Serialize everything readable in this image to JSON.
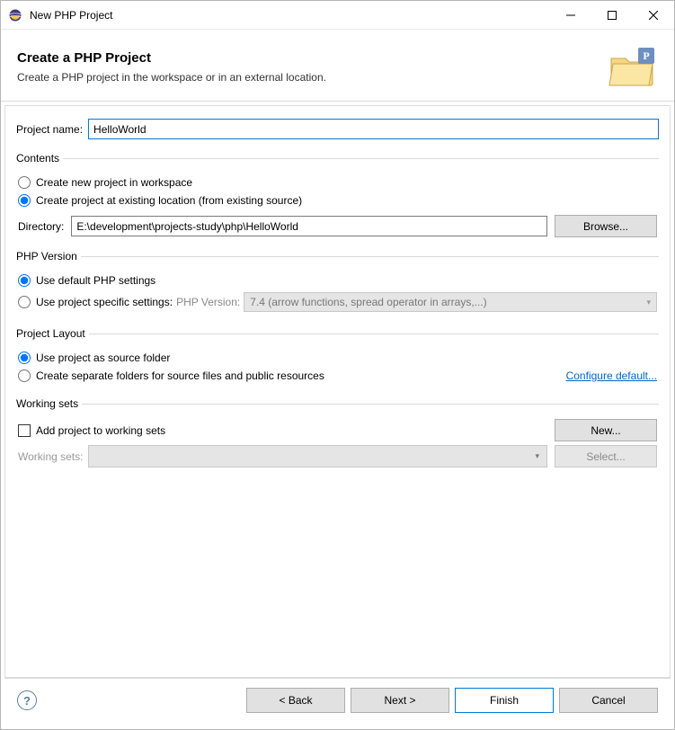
{
  "window": {
    "title": "New PHP Project"
  },
  "header": {
    "title": "Create a PHP Project",
    "subtitle": "Create a PHP project in the workspace or in an external location."
  },
  "project_name": {
    "label": "Project name:",
    "value": "HelloWorld"
  },
  "contents": {
    "legend": "Contents",
    "opt_new": "Create new project in workspace",
    "opt_existing": "Create project at existing location (from existing source)",
    "dir_label": "Directory:",
    "dir_value": "E:\\development\\projects-study\\php\\HelloWorld",
    "browse": "Browse..."
  },
  "php_version": {
    "legend": "PHP Version",
    "opt_default": "Use default PHP settings",
    "opt_specific": "Use project specific settings:",
    "combo_label": "PHP Version:",
    "combo_value": "7.4 (arrow functions, spread operator in arrays,...)"
  },
  "layout": {
    "legend": "Project Layout",
    "opt_source": "Use project as source folder",
    "opt_separate": "Create separate folders for source files and public resources",
    "configure_link": "Configure default..."
  },
  "working_sets": {
    "legend": "Working sets",
    "add_label": "Add project to working sets",
    "new_btn": "New...",
    "ws_label": "Working sets:",
    "select_btn": "Select..."
  },
  "footer": {
    "back": "< Back",
    "next": "Next >",
    "finish": "Finish",
    "cancel": "Cancel"
  }
}
